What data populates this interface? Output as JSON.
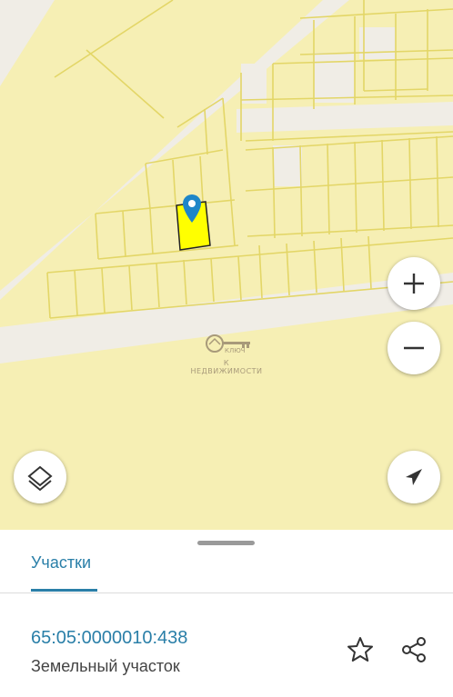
{
  "map": {
    "watermark_brand": "КЛЮЧ",
    "watermark_caption": "К НЕДВИЖИМОСТИ",
    "controls": {
      "zoom_in_icon": "plus-icon",
      "zoom_out_icon": "minus-icon",
      "layers_icon": "layers-icon",
      "locate_icon": "navigation-arrow-icon"
    },
    "colors": {
      "land": "#f6efb4",
      "parcel_border": "#e3d667",
      "road": "#f0ede6",
      "selected_parcel": "#ffff00",
      "pin": "#1e86c8"
    }
  },
  "sheet": {
    "tab_label": "Участки",
    "parcel": {
      "cadastral_number": "65:05:0000010:438",
      "type": "Земельный участок"
    },
    "actions": {
      "favorite_icon": "star-icon",
      "share_icon": "share-icon"
    }
  }
}
